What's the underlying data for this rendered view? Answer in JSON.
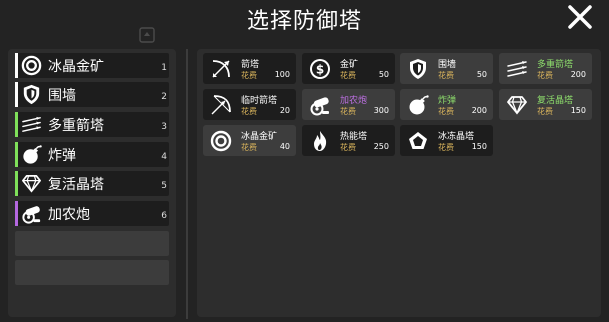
{
  "title": "选择防御塔",
  "colors": {
    "background": "#232323",
    "panel": "#2d2d2d",
    "slot": "#1d1d1d",
    "cost_label": "#d8b35c",
    "purple_name": "#bb6fe0",
    "green_name": "#8fe06d"
  },
  "slots": [
    {
      "label": "冰晶金矿",
      "num": "1",
      "icon": "ring-target-icon",
      "bar_color": "#ffffff"
    },
    {
      "label": "围墙",
      "num": "2",
      "icon": "shield-icon",
      "bar_color": "#ffffff"
    },
    {
      "label": "多重箭塔",
      "num": "3",
      "icon": "triple-arrow-icon",
      "bar_color": "#7fe05a"
    },
    {
      "label": "炸弹",
      "num": "4",
      "icon": "bomb-icon",
      "bar_color": "#7fe05a"
    },
    {
      "label": "复活晶塔",
      "num": "5",
      "icon": "diamond-icon",
      "bar_color": "#7fe05a"
    },
    {
      "label": "加农炮",
      "num": "6",
      "icon": "cannon-icon",
      "bar_color": "#b568e0"
    }
  ],
  "cost_label": "花费",
  "towers": [
    {
      "name": "箭塔",
      "cost": "100",
      "icon": "arrow-icon",
      "name_color": "white",
      "selected": false
    },
    {
      "name": "金矿",
      "cost": "50",
      "icon": "dollar-coin-icon",
      "name_color": "white",
      "selected": false
    },
    {
      "name": "围墙",
      "cost": "50",
      "icon": "shield-icon",
      "name_color": "white",
      "selected": true
    },
    {
      "name": "多重箭塔",
      "cost": "200",
      "icon": "triple-arrow-icon",
      "name_color": "green",
      "selected": true
    },
    {
      "name": "临时箭塔",
      "cost": "20",
      "icon": "bow-icon",
      "name_color": "white",
      "selected": false
    },
    {
      "name": "加农炮",
      "cost": "300",
      "icon": "cannon-icon",
      "name_color": "purple",
      "selected": true
    },
    {
      "name": "炸弹",
      "cost": "200",
      "icon": "bomb-icon",
      "name_color": "green",
      "selected": true
    },
    {
      "name": "复活晶塔",
      "cost": "150",
      "icon": "diamond-icon",
      "name_color": "green",
      "selected": true
    },
    {
      "name": "冰晶金矿",
      "cost": "40",
      "icon": "ring-target-icon",
      "name_color": "white",
      "selected": true
    },
    {
      "name": "热能塔",
      "cost": "250",
      "icon": "flame-icon",
      "name_color": "white",
      "selected": false
    },
    {
      "name": "冰冻晶塔",
      "cost": "150",
      "icon": "pentagon-icon",
      "name_color": "white",
      "selected": false
    }
  ]
}
